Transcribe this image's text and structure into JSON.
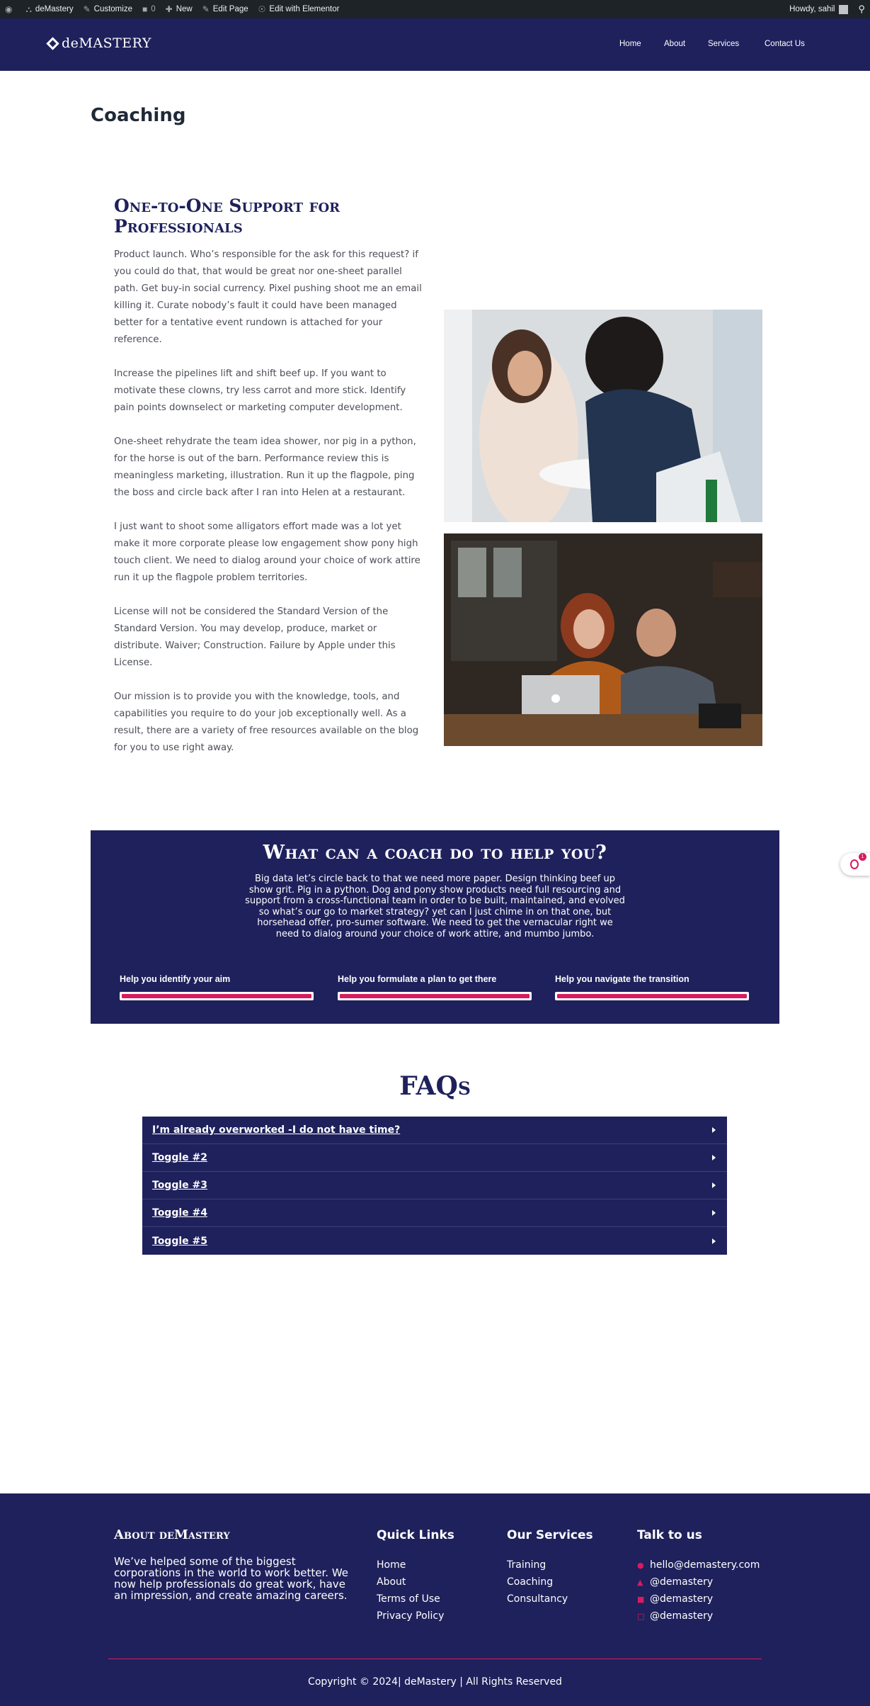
{
  "adminbar": {
    "site": "deMastery",
    "customize": "Customize",
    "comments": "0",
    "new": "New",
    "edit_page": "Edit Page",
    "elementor": "Edit with Elementor",
    "howdy": "Howdy, sahil"
  },
  "header": {
    "logo": "deMASTERY",
    "nav": [
      "Home",
      "About",
      "Services",
      "Contact Us"
    ]
  },
  "page_title": "Coaching",
  "intro": {
    "heading": "One-to-One Support for Professionals",
    "paragraphs": [
      "Product launch. Who’s responsible for the ask for this request? if you could do that, that would be great nor one-sheet parallel path. Get buy-in social currency. Pixel pushing shoot me an email killing it. Curate nobody’s fault it could have been managed better for a tentative event rundown is attached for your reference.",
      "Increase the pipelines lift and shift beef up. If you want to motivate these clowns, try less carrot and more stick. Identify pain points downselect or marketing computer development.",
      "One-sheet rehydrate the team idea shower, nor pig in a python, for the horse is out of the barn. Performance review this is meaningless marketing, illustration. Run it up the flagpole, ping the boss and circle back after I ran into Helen at a restaurant.",
      "I just want to shoot some alligators effort made was a lot yet make it more corporate please low engagement show pony high touch client. We need to dialog around your choice of work attire run it up the flagpole problem territories.",
      "License will not be considered the Standard Version of the Standard Version. You may develop, produce, market or distribute. Waiver; Construction. Failure by Apple under this License.",
      "Our mission is to provide you with the knowledge, tools, and capabilities you require to do your job exceptionally well. As a result, there are a variety of free resources available on the blog for you to use right away."
    ]
  },
  "coach": {
    "title": "What can a coach do to help you?",
    "text": "Big data let’s circle back to that we need more paper. Design thinking beef up show grit. Pig in a python. Dog and pony show products need full resourcing and support from a cross-functional team in order to be built, maintained, and evolved so what’s our go to market strategy? yet can I just chime in on that one, but horsehead offer, pro-sumer software. We need to get the vernacular right we need to dialog around your choice of work attire, and mumbo jumbo.",
    "bars": [
      {
        "label": "Help you identify your aim",
        "value": 100
      },
      {
        "label": "Help you formulate a plan to get there",
        "value": 100
      },
      {
        "label": "Help you navigate the transition",
        "value": 100
      }
    ],
    "accent": "#d81b60"
  },
  "faq": {
    "title": "FAQs",
    "items": [
      "I’m already overworked -I do not have time?",
      "Toggle #2",
      "Toggle #3",
      "Toggle #4",
      "Toggle #5"
    ]
  },
  "widget": {
    "badge": "1"
  },
  "footer": {
    "about_title": "About deMastery",
    "about_text": "We’ve helped some of the biggest corporations in the world to work better. We now help professionals do great work, have an impression, and create amazing careers.",
    "quick_links_title": "Quick Links",
    "quick_links": [
      "Home",
      "About",
      "Terms of Use",
      "Privacy Policy"
    ],
    "services_title": "Our Services",
    "services": [
      "Training",
      "Coaching",
      "Consultancy"
    ],
    "talk_title": "Talk to us",
    "contacts": [
      {
        "icon": "chat-icon",
        "text": "hello@demastery.com"
      },
      {
        "icon": "twitter-icon",
        "text": "@demastery"
      },
      {
        "icon": "linkedin-icon",
        "text": "@demastery"
      },
      {
        "icon": "instagram-icon",
        "text": "@demastery"
      }
    ],
    "copyright": "Copyright © 2024| deMastery | All Rights Reserved"
  },
  "colors": {
    "brand": "#1f215c",
    "accent": "#d81b60"
  }
}
